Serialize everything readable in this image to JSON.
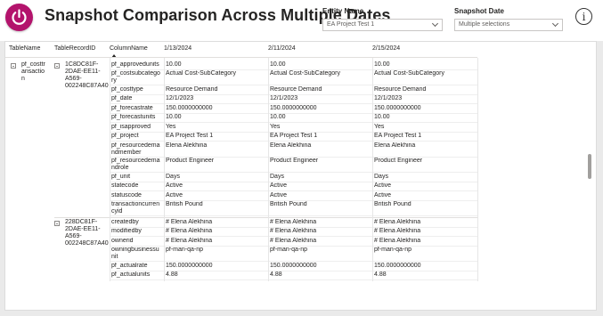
{
  "header": {
    "title": "Snapshot Comparison Across Multiple Dates",
    "logo_icon": "power-icon",
    "info_icon": "info-icon",
    "accent_color": "#b3136c"
  },
  "slicers": {
    "entity": {
      "label": "Entity Name",
      "value": "EA Project Test 1"
    },
    "snapshot": {
      "label": "Snapshot Date",
      "value": "Multiple selections"
    }
  },
  "table": {
    "columns": [
      "TableName",
      "TableRecordID",
      "ColumnName",
      "1/13/2024",
      "2/11/2024",
      "2/15/2024"
    ],
    "table_name": "pf_costtr\nansactio\nn",
    "groups": [
      {
        "record_id": "1C8DC81F-\n2DAE-EE11-\nA569-\n002248C87A40",
        "rows": [
          [
            "pf_approvedunits",
            "10.00",
            "10.00",
            "10.00"
          ],
          [
            "pf_costsubcatego\nry",
            "Actual Cost-SubCategory",
            "Actual Cost-SubCategory",
            "Actual Cost-SubCategory"
          ],
          [
            "pf_costtype",
            "Resource Demand",
            "Resource Demand",
            "Resource Demand"
          ],
          [
            "pf_date",
            "12/1/2023",
            "12/1/2023",
            "12/1/2023"
          ],
          [
            "pf_forecastrate",
            "150.0000000000",
            "150.0000000000",
            "150.0000000000"
          ],
          [
            "pf_forecastunits",
            "10.00",
            "10.00",
            "10.00"
          ],
          [
            "pf_isapproved",
            "Yes",
            "Yes",
            "Yes"
          ],
          [
            "pf_project",
            "EA Project Test 1",
            "EA Project Test 1",
            "EA Project Test 1"
          ],
          [
            "pf_resourcedema\nndmember",
            "Elena Alekhina",
            "Elena Alekhina",
            "Elena Alekhina"
          ],
          [
            "pf_resourcedema\nndrole",
            "Product Engineer",
            "Product Engineer",
            "Product Engineer"
          ],
          [
            "pf_unit",
            "Days",
            "Days",
            "Days"
          ],
          [
            "statecode",
            "Active",
            "Active",
            "Active"
          ],
          [
            "statuscode",
            "Active",
            "Active",
            "Active"
          ],
          [
            "transactioncurren\ncyid",
            "British Pound",
            "British Pound",
            "British Pound"
          ]
        ]
      },
      {
        "record_id": "228DC81F-\n2DAE-EE11-\nA569-\n002248C87A40",
        "rows": [
          [
            "createdby",
            "# Elena Alekhina",
            "# Elena Alekhina",
            "# Elena Alekhina"
          ],
          [
            "modifiedby",
            "# Elena Alekhina",
            "# Elena Alekhina",
            "# Elena Alekhina"
          ],
          [
            "ownerid",
            "# Elena Alekhina",
            "# Elena Alekhina",
            "# Elena Alekhina"
          ],
          [
            "owningbusinessu\nnit",
            "pf-man-qa-np",
            "pf-man-qa-np",
            "pf-man-qa-np"
          ],
          [
            "pf_actualrate",
            "150.0000000000",
            "150.0000000000",
            "150.0000000000"
          ],
          [
            "pf_actualunits",
            "4.88",
            "4.88",
            "4.88"
          ]
        ]
      }
    ]
  }
}
